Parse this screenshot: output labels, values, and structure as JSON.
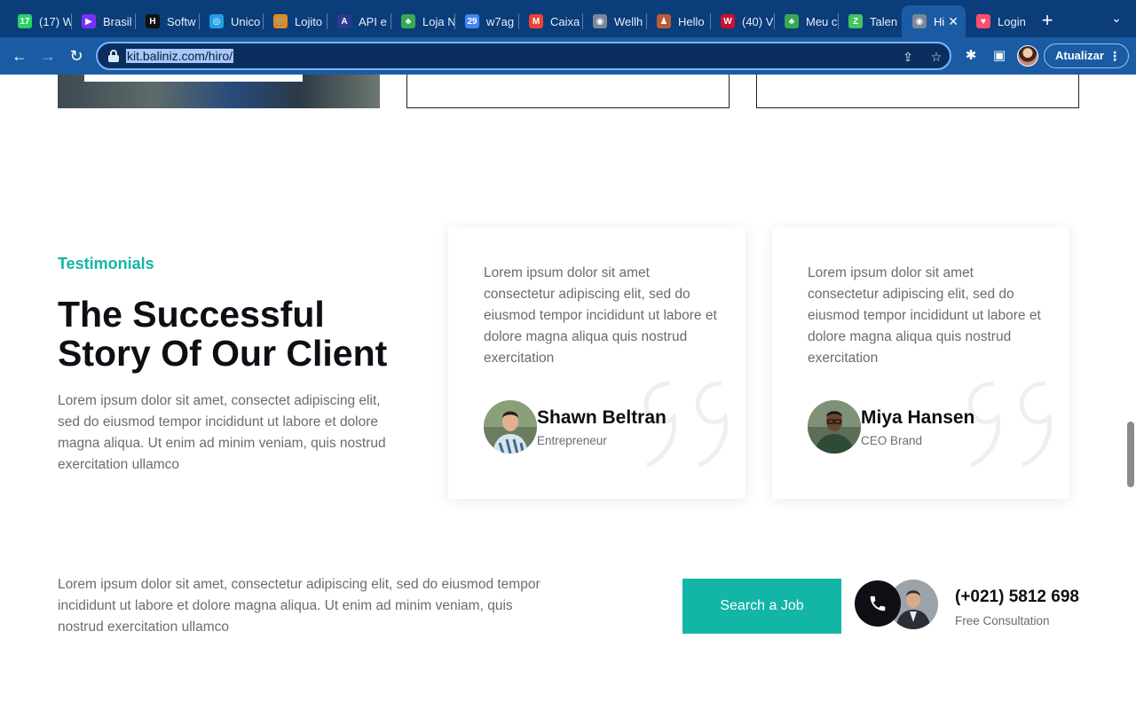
{
  "browser": {
    "tabs": [
      {
        "label": "(17) W",
        "icon": "whatsapp-icon",
        "color": "#25d366",
        "glyph": "17"
      },
      {
        "label": "Brasil",
        "icon": "vercel-like-icon",
        "color": "#7b2ff7",
        "glyph": "▶"
      },
      {
        "label": "Softw",
        "icon": "h-logo-icon",
        "color": "#111111",
        "glyph": "H"
      },
      {
        "label": "Unico",
        "icon": "unico-icon",
        "color": "#1fa0e3",
        "glyph": "◎"
      },
      {
        "label": "Lojito",
        "icon": "cart-icon",
        "color": "#e08a1e",
        "glyph": "🛒"
      },
      {
        "label": "API e",
        "icon": "api-icon",
        "color": "#2a3b8f",
        "glyph": "A"
      },
      {
        "label": "Loja N",
        "icon": "leaf-icon",
        "color": "#38a852",
        "glyph": "♣"
      },
      {
        "label": "w7ag",
        "icon": "calendar-icon",
        "color": "#4285f4",
        "glyph": "29"
      },
      {
        "label": "Caixa",
        "icon": "gmail-icon",
        "color": "#ea4335",
        "glyph": "M"
      },
      {
        "label": "Wellh",
        "icon": "globe-icon",
        "color": "#7a8794",
        "glyph": "◉"
      },
      {
        "label": "Hello",
        "icon": "person-icon",
        "color": "#b85c38",
        "glyph": "♟"
      },
      {
        "label": "(40) V",
        "icon": "w-logo-icon",
        "color": "#c4122f",
        "glyph": "W"
      },
      {
        "label": "Meu c",
        "icon": "leaf-icon",
        "color": "#38a852",
        "glyph": "♣"
      },
      {
        "label": "Talen",
        "icon": "talent-icon",
        "color": "#43c463",
        "glyph": "Z"
      },
      {
        "label": "Hi",
        "icon": "globe-icon",
        "color": "#7a8794",
        "glyph": "◉"
      },
      {
        "label": "Login",
        "icon": "heart-icon",
        "color": "#ff4d6d",
        "glyph": "♥"
      }
    ],
    "active_tab_index": 14,
    "url": "kit.baliniz.com/hiro/",
    "update_label": "Atualizar"
  },
  "testimonials": {
    "tag": "Testimonials",
    "title": "The Successful Story Of Our Client",
    "description": "Lorem ipsum dolor sit amet, consectet adipiscing elit, sed do eiusmod tempor incididunt ut labore et dolore magna aliqua. Ut enim ad minim veniam, quis nostrud exercitation ullamco",
    "cards": [
      {
        "quote": "Lorem ipsum dolor sit amet consectetur adipiscing elit, sed do eiusmod tempor incididunt ut labore et dolore magna aliqua quis nostrud exercitation",
        "name": "Shawn Beltran",
        "role": "Entrepreneur"
      },
      {
        "quote": "Lorem ipsum dolor sit amet consectetur adipiscing elit, sed do eiusmod tempor incididunt ut labore et dolore magna aliqua quis nostrud exercitation",
        "name": "Miya Hansen",
        "role": "CEO Brand"
      }
    ]
  },
  "cta": {
    "text": "Lorem ipsum dolor sit amet, consectetur adipiscing elit, sed do eiusmod tempor incididunt ut labore et dolore magna aliqua. Ut enim ad minim veniam, quis nostrud exercitation ullamco",
    "button_label": "Search a Job",
    "phone": "(+021) 5812 698",
    "phone_caption": "Free Consultation"
  },
  "colors": {
    "accent": "#13b5a7",
    "heading": "#0e0e14",
    "body_text": "#6b6b72",
    "chrome_dark": "#0b3d7a",
    "chrome": "#1a5ba3"
  }
}
